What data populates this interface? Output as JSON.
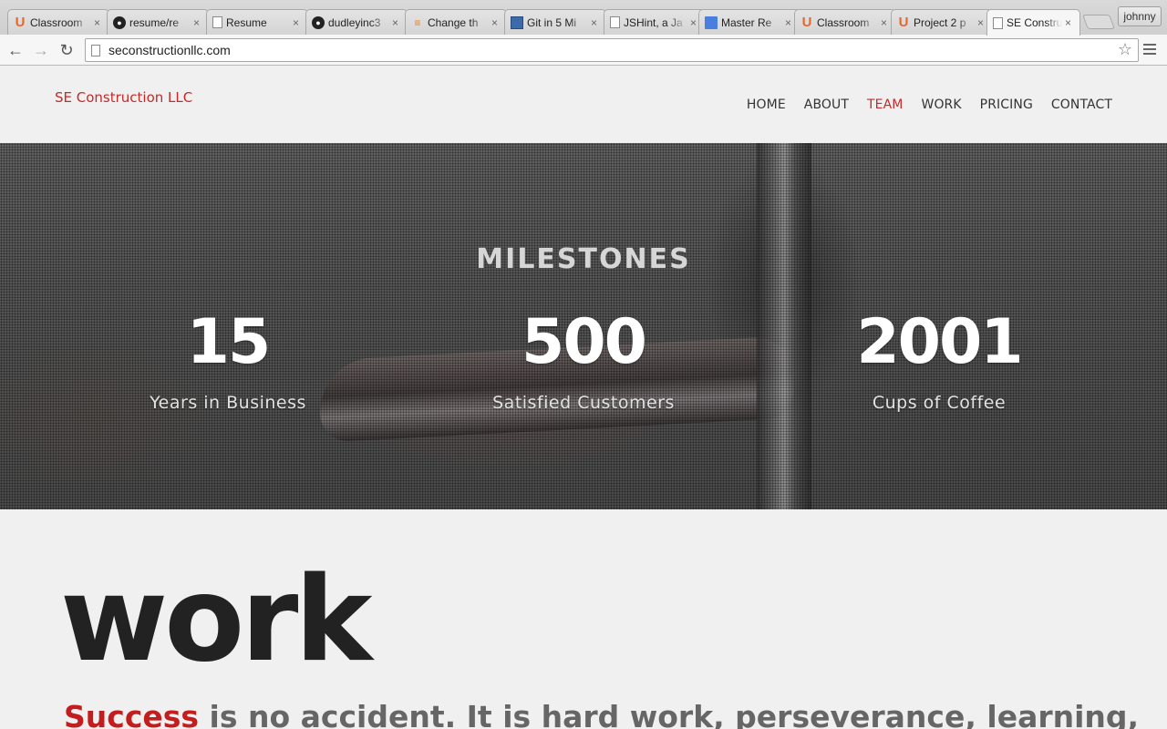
{
  "browser": {
    "tabs": [
      {
        "title": "Classroom",
        "favicon": "udacity-icon"
      },
      {
        "title": "resume/re",
        "favicon": "github-icon"
      },
      {
        "title": "Resume",
        "favicon": "document-icon"
      },
      {
        "title": "dudleyinc3",
        "favicon": "github-icon"
      },
      {
        "title": "Change th",
        "favicon": "stackoverflow-icon"
      },
      {
        "title": "Git in 5 Mi",
        "favicon": "blue-square-icon"
      },
      {
        "title": "JSHint, a Ja",
        "favicon": "document-icon"
      },
      {
        "title": "Master Re",
        "favicon": "google-docs-icon"
      },
      {
        "title": "Classroom",
        "favicon": "udacity-icon"
      },
      {
        "title": "Project 2 p",
        "favicon": "udacity-icon"
      },
      {
        "title": "SE Constru",
        "favicon": "document-icon",
        "active": true
      }
    ],
    "profile_name": "johnny",
    "url": "seconstructionllc.com",
    "back_glyph": "←",
    "forward_glyph": "→",
    "reload_glyph": "↻",
    "star_glyph": "☆",
    "close_glyph": "×"
  },
  "site": {
    "logo": "SE Construction LLC",
    "nav": [
      "HOME",
      "ABOUT",
      "TEAM",
      "WORK",
      "PRICING",
      "CONTACT"
    ],
    "nav_active": "TEAM"
  },
  "milestones": {
    "title": "MILESTONES",
    "stats": [
      {
        "number": "15",
        "label": "Years in Business"
      },
      {
        "number": "500",
        "label": "Satisfied Customers"
      },
      {
        "number": "2001",
        "label": "Cups of Coffee"
      }
    ]
  },
  "work": {
    "title": "work",
    "quote_accent": "Success",
    "quote_rest": " is no accident. It is hard work, perseverance, learning,"
  },
  "colors": {
    "accent": "#c62a2a",
    "text_dark": "#222222",
    "quote_gray": "#666666",
    "page_bg": "#f0f0f0"
  }
}
